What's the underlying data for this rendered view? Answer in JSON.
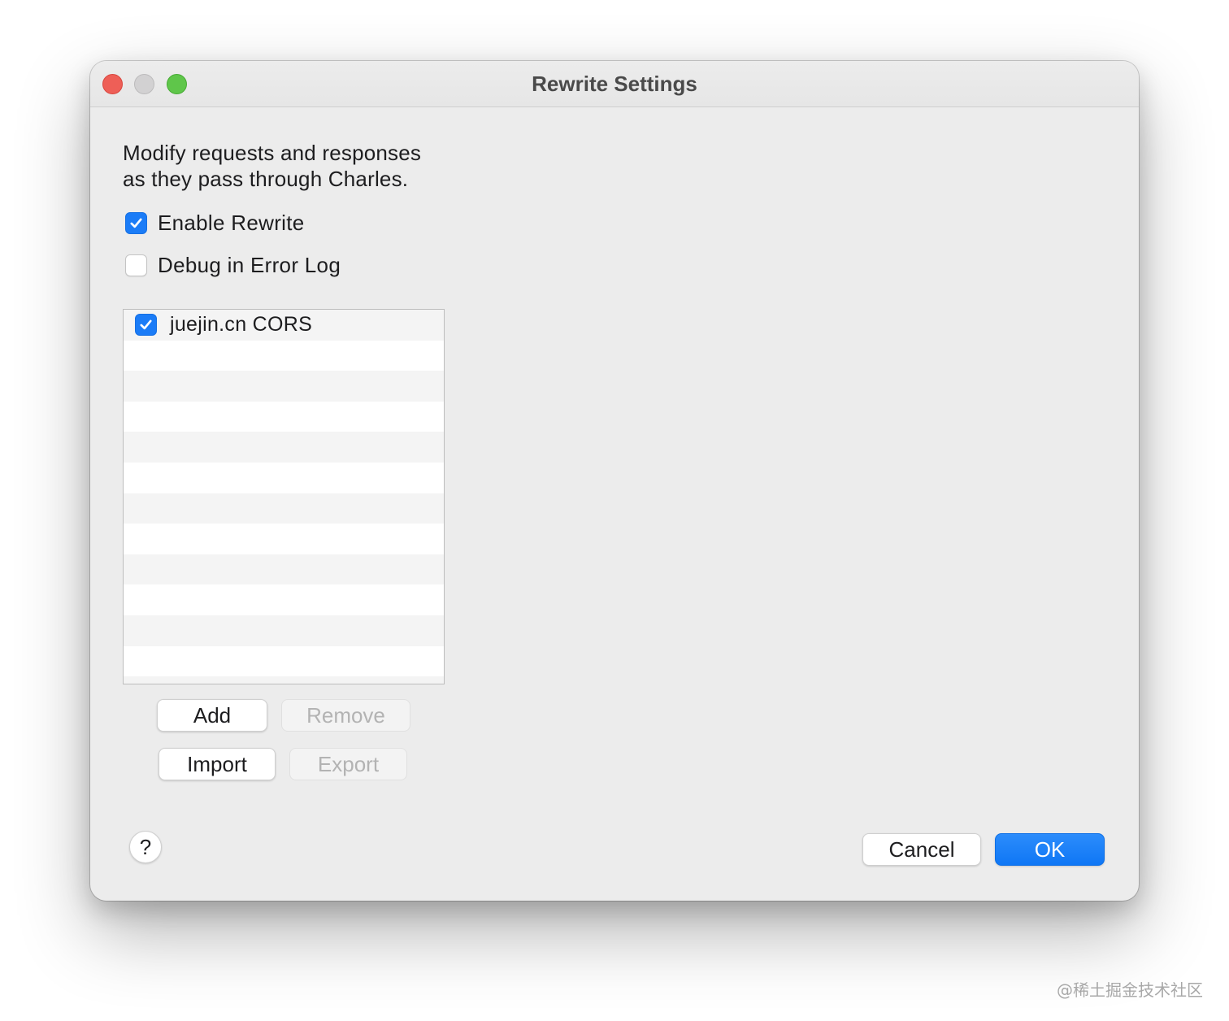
{
  "window": {
    "title": "Rewrite Settings"
  },
  "description": {
    "line1": "Modify requests and responses",
    "line2": "as they pass through Charles."
  },
  "options": {
    "enable_rewrite": {
      "label": "Enable Rewrite",
      "checked": true
    },
    "debug_error_log": {
      "label": "Debug in Error Log",
      "checked": false
    }
  },
  "rules": {
    "items": [
      {
        "label": "juejin.cn CORS",
        "checked": true
      }
    ]
  },
  "buttons": {
    "add": "Add",
    "remove": "Remove",
    "import": "Import",
    "export": "Export",
    "cancel": "Cancel",
    "ok": "OK",
    "help": "?"
  },
  "colors": {
    "accent": "#1b7cf7",
    "close": "#ee5f57",
    "minimize": "#d2d1d2",
    "zoom": "#5fc64a"
  },
  "icons": {
    "checkmark": "checkmark-icon",
    "help": "question-mark-icon"
  },
  "watermark": "@稀土掘金技术社区"
}
